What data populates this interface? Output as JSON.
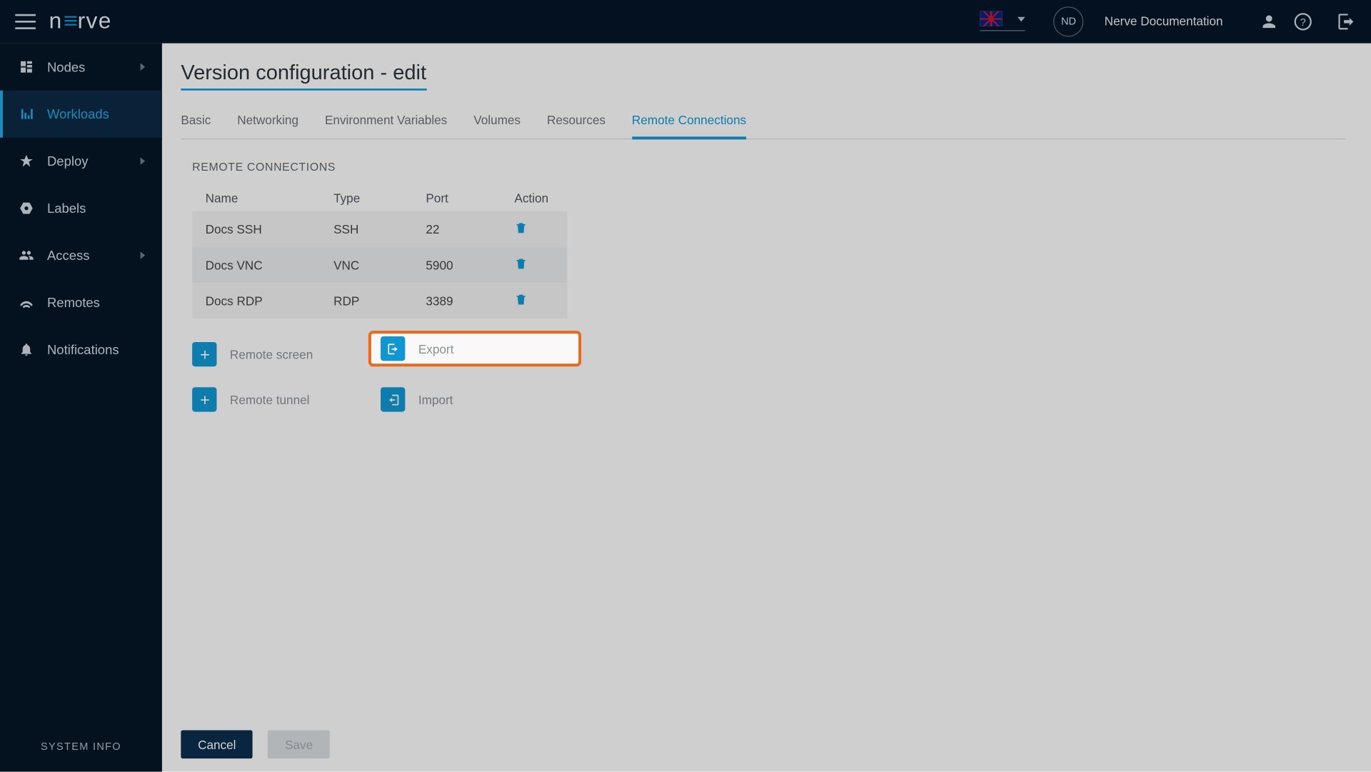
{
  "header": {
    "logo_text1": "n",
    "logo_text2": "rve",
    "avatar_initials": "ND",
    "doc_link": "Nerve Documentation"
  },
  "sidebar": {
    "items": [
      {
        "label": "Nodes",
        "expandable": true
      },
      {
        "label": "Workloads",
        "expandable": false
      },
      {
        "label": "Deploy",
        "expandable": true
      },
      {
        "label": "Labels",
        "expandable": false
      },
      {
        "label": "Access",
        "expandable": true
      },
      {
        "label": "Remotes",
        "expandable": false
      },
      {
        "label": "Notifications",
        "expandable": false
      }
    ],
    "system_info": "SYSTEM INFO"
  },
  "page": {
    "title": "Version configuration - edit",
    "tabs": [
      "Basic",
      "Networking",
      "Environment Variables",
      "Volumes",
      "Resources",
      "Remote Connections"
    ],
    "active_tab_index": 5,
    "section_label": "REMOTE CONNECTIONS",
    "columns": {
      "c0": "Name",
      "c1": "Type",
      "c2": "Port",
      "c3": "Action"
    },
    "rows": [
      {
        "name": "Docs SSH",
        "type": "SSH",
        "port": "22"
      },
      {
        "name": "Docs VNC",
        "type": "VNC",
        "port": "5900"
      },
      {
        "name": "Docs RDP",
        "type": "RDP",
        "port": "3389"
      }
    ],
    "actions": {
      "remote_screen": "Remote screen",
      "remote_tunnel": "Remote tunnel",
      "export": "Export",
      "import": "Import"
    },
    "buttons": {
      "cancel": "Cancel",
      "save": "Save"
    }
  }
}
